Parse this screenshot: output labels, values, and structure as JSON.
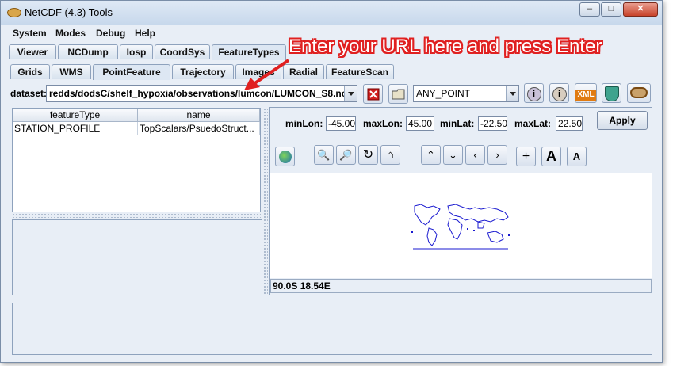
{
  "window": {
    "title": "NetCDF (4.3) Tools"
  },
  "menubar": {
    "items": [
      "System",
      "Modes",
      "Debug",
      "Help"
    ]
  },
  "main_tabs": [
    "Viewer",
    "NCDump",
    "Iosp",
    "CoordSys",
    "FeatureTypes"
  ],
  "feature_tabs": [
    "Grids",
    "WMS",
    "PointFeature",
    "Trajectory",
    "Images",
    "Radial",
    "FeatureScan"
  ],
  "dataset": {
    "label": "dataset:",
    "value": "redds/dodsC/shelf_hypoxia/observations/lumcon/LUMCON_S8.nc",
    "type_value": "ANY_POINT"
  },
  "table": {
    "columns": [
      "featureType",
      "name"
    ],
    "rows": [
      [
        "STATION_PROFILE",
        "TopScalars/PsuedoStruct..."
      ]
    ]
  },
  "bbox": {
    "minLon_label": "minLon:",
    "minLon": "-45.00",
    "maxLon_label": "maxLon:",
    "maxLon": "45.00",
    "minLat_label": "minLat:",
    "minLat": "-22.50",
    "maxLat_label": "maxLat:",
    "maxLat": "22.50",
    "apply_label": "Apply"
  },
  "map_status": "90.0S 18.54E",
  "toolbar_icons": [
    "info-icon",
    "info-icon",
    "xml-icon",
    "shield-icon",
    "storage-icon"
  ],
  "map_tools": [
    "globe-icon",
    "zoom-in-icon",
    "zoom-out-icon",
    "reset-icon",
    "home-icon",
    "up-icon",
    "down-icon",
    "left-icon",
    "right-icon",
    "plus-icon",
    "font-larger-icon",
    "font-smaller-icon"
  ],
  "annotation": {
    "text": "Enter your URL here and press Enter",
    "color": "#e02020"
  }
}
